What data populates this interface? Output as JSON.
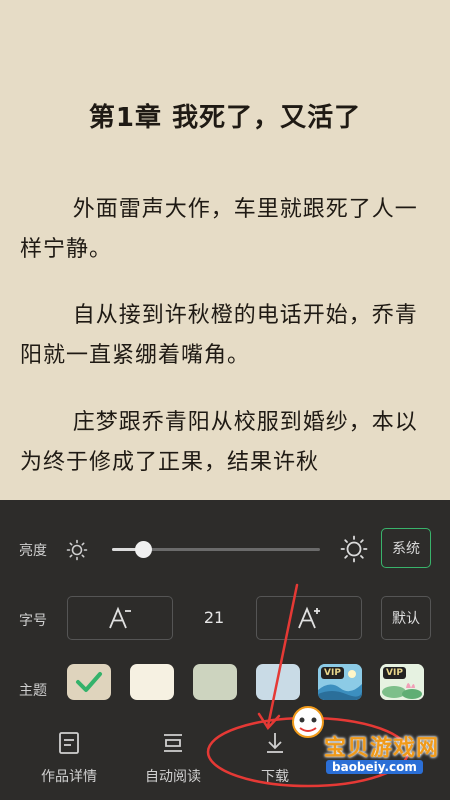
{
  "reader": {
    "chapter_title": "第1章 我死了，又活了",
    "paragraphs": [
      "外面雷声大作，车里就跟死了人一样宁静。",
      "自从接到许秋橙的电话开始，乔青阳就一直紧绷着嘴角。",
      "庄梦跟乔青阳从校服到婚纱，本以为终于修成了正果，结果许秋"
    ]
  },
  "settings": {
    "brightness": {
      "label": "亮度",
      "level": 0.15,
      "system_button": "系统",
      "low_icon": "sun-small-icon",
      "high_icon": "sun-large-icon"
    },
    "font_size": {
      "label": "字号",
      "value": "21",
      "default_button": "默认",
      "decrease_icon": "font-decrease-icon",
      "increase_icon": "font-increase-icon"
    },
    "theme": {
      "label": "主题",
      "selected_index": 0,
      "swatches": [
        {
          "color": "#dfd4bd",
          "badge": ""
        },
        {
          "color": "#f6f1e2",
          "badge": ""
        },
        {
          "color": "#cdd4bf",
          "badge": ""
        },
        {
          "color": "#c9dbe6",
          "badge": ""
        },
        {
          "color": "#7ec2dd",
          "badge": "VIP"
        },
        {
          "color": "#e3f0de",
          "badge": "VIP"
        }
      ]
    }
  },
  "tabs": [
    {
      "label": "作品详情",
      "icon": "book-details-icon"
    },
    {
      "label": "自动阅读",
      "icon": "auto-read-icon"
    },
    {
      "label": "下载",
      "icon": "download-icon"
    }
  ],
  "watermark": {
    "text": "宝贝游戏网",
    "url": "baobeiy.com"
  },
  "colors": {
    "accent": "#39b36b",
    "annotation": "#e53935",
    "panel": "#1e1e1e",
    "page": "#e6dcc6"
  }
}
